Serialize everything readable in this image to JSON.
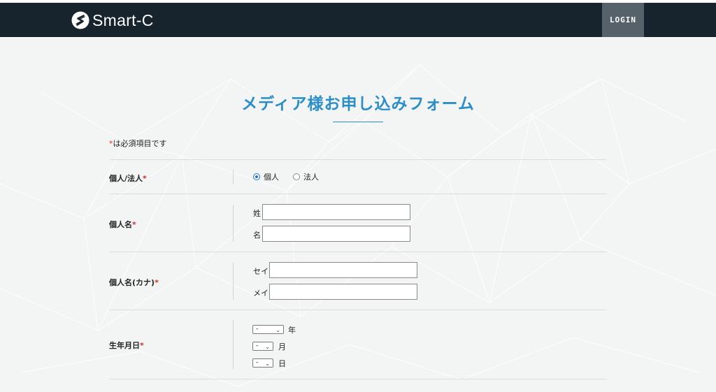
{
  "header": {
    "brand": "Smart-C",
    "login_label": "LOGIN"
  },
  "form": {
    "title": "メディア様お申し込みフォーム",
    "required_mark": "*",
    "required_note": "は必須項目です",
    "rows": {
      "type": {
        "label": "個人/法人",
        "options": [
          "個人",
          "法人"
        ],
        "selected": "個人"
      },
      "name": {
        "label": "個人名",
        "last_label": "姓",
        "first_label": "名",
        "last_value": "",
        "first_value": ""
      },
      "kana": {
        "label": "個人名(カナ)",
        "last_label": "セイ",
        "first_label": "メイ",
        "last_value": "",
        "first_value": ""
      },
      "birthday": {
        "label": "生年月日",
        "year_value": "-",
        "month_value": "-",
        "day_value": "-",
        "year_unit": "年",
        "month_unit": "月",
        "day_unit": "日"
      }
    }
  },
  "colors": {
    "header_bg": "#18242d",
    "login_bg": "#56616a",
    "accent": "#2b8ec7",
    "required": "#d0312d",
    "page_bg": "#f3f4f4"
  }
}
